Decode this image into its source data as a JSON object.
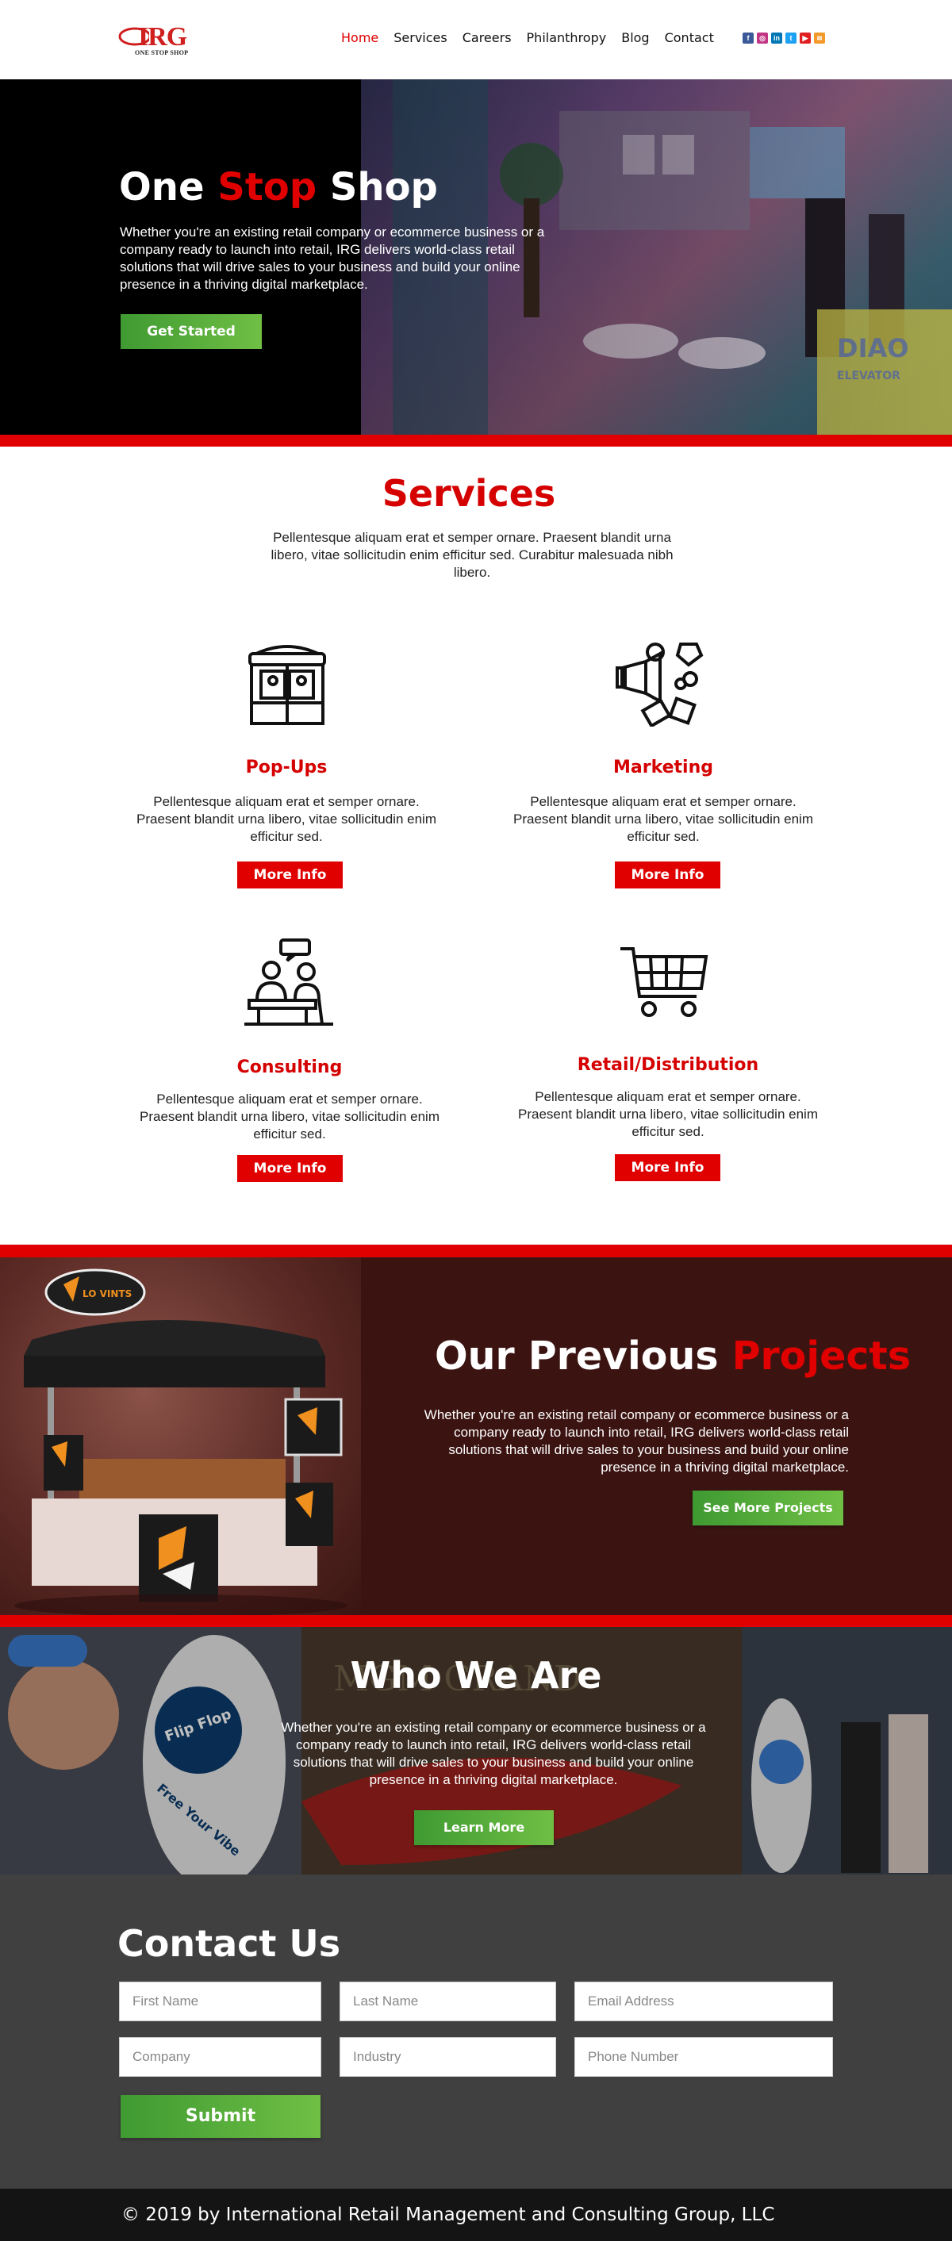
{
  "colors": {
    "accent_red": "#e00000",
    "green": "#4fa838",
    "dark_brown": "#3b1412",
    "contact_bg": "#404040",
    "footer_bg": "#141414"
  },
  "header": {
    "logo_text": "IRG",
    "logo_sub": "ONE STOP SHOP",
    "nav": [
      {
        "label": "Home",
        "active": true
      },
      {
        "label": "Services",
        "active": false
      },
      {
        "label": "Careers",
        "active": false
      },
      {
        "label": "Philanthropy",
        "active": false
      },
      {
        "label": "Blog",
        "active": false
      },
      {
        "label": "Contact",
        "active": false
      }
    ],
    "social_icons": [
      "facebook-icon",
      "instagram-icon",
      "linkedin-icon",
      "twitter-icon",
      "youtube-icon",
      "rss-icon"
    ]
  },
  "hero": {
    "title_part1": "One ",
    "title_part2": "Stop",
    "title_part3": " Shop",
    "text": "Whether you're an existing retail company or ecommerce business or a company ready to launch into retail, IRG delivers world-class retail solutions that will drive sales to your business and build your online presence in a thriving digital marketplace.",
    "button": "Get Started"
  },
  "services": {
    "title": "Services",
    "intro": "Pellentesque aliquam erat et semper ornare. Praesent blandit urna libero, vitae sollicitudin enim efficitur sed. Curabitur malesuada nibh libero.",
    "items": [
      {
        "title": "Pop-Ups",
        "text": "Pellentesque aliquam erat et semper ornare. Praesent blandit urna libero, vitae sollicitudin enim efficitur sed.",
        "button": "More Info",
        "icon": "kiosk-icon"
      },
      {
        "title": "Marketing",
        "text": "Pellentesque aliquam erat et semper ornare. Praesent blandit urna libero, vitae sollicitudin enim efficitur sed.",
        "button": "More Info",
        "icon": "megaphone-icon"
      },
      {
        "title": "Consulting",
        "text": "Pellentesque aliquam erat et semper ornare. Praesent blandit urna libero, vitae sollicitudin enim efficitur sed.",
        "button": "More Info",
        "icon": "meeting-icon"
      },
      {
        "title": "Retail/Distribution",
        "text": "Pellentesque aliquam erat et semper ornare. Praesent blandit urna libero, vitae sollicitudin enim efficitur sed.",
        "button": "More Info",
        "icon": "shopping-cart-icon"
      }
    ]
  },
  "projects": {
    "title_part1": "Our Previous ",
    "title_part2": "Projects",
    "text": "Whether you're an existing retail company or ecommerce business or a company ready to launch into retail, IRG delivers world-class retail solutions that will drive sales to your business and build your online presence in a thriving digital marketplace.",
    "button": "See More Projects",
    "booth_brand": "LO VINTS"
  },
  "who": {
    "title": "Who We Are",
    "text": "Whether you're an existing retail company or ecommerce business or a company ready to launch into retail, IRG delivers world-class retail solutions that will drive sales to your business and build your online presence in a thriving digital marketplace.",
    "button": "Learn More",
    "photo_text_1": "Flip Flop",
    "photo_text_2": "Free Your Vibe",
    "photo_text_3": "MGM GRAND"
  },
  "contact": {
    "title": "Contact Us",
    "fields": [
      {
        "placeholder": "First Name"
      },
      {
        "placeholder": "Last Name"
      },
      {
        "placeholder": "Email Address"
      },
      {
        "placeholder": "Company"
      },
      {
        "placeholder": "Industry"
      },
      {
        "placeholder": "Phone Number"
      }
    ],
    "submit": "Submit"
  },
  "footer": {
    "text": "© 2019 by International Retail Management and Consulting Group, LLC"
  }
}
